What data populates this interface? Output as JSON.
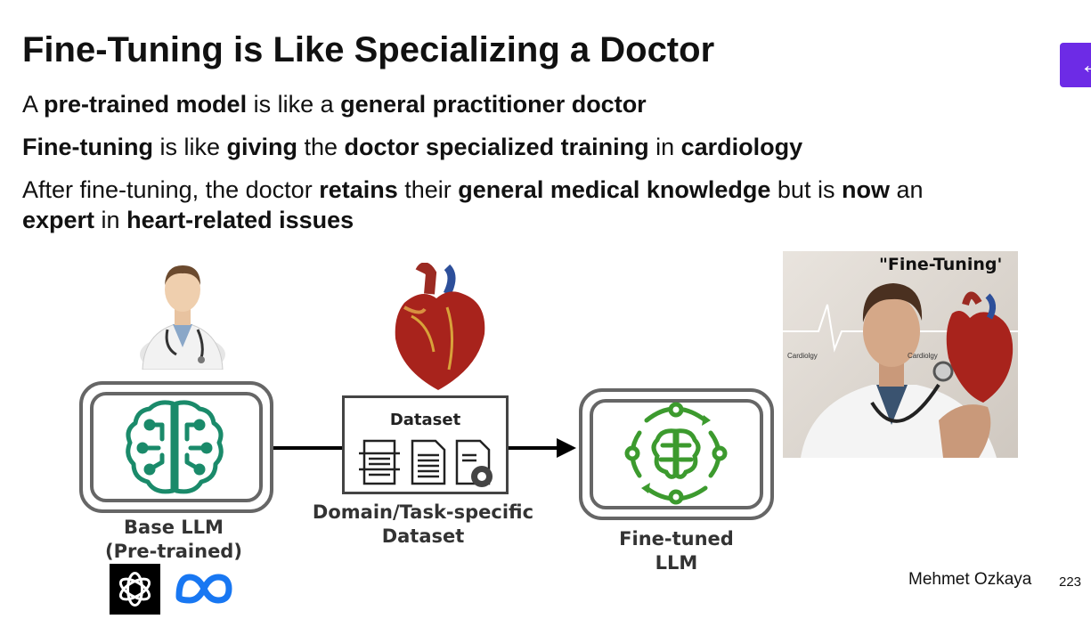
{
  "slide": {
    "title": "Fine-Tuning is Like Specializing a Doctor",
    "bullets": [
      [
        {
          "t": "A ",
          "b": false
        },
        {
          "t": "pre-trained model",
          "b": true
        },
        {
          "t": " is like a ",
          "b": false
        },
        {
          "t": "general practitioner doctor",
          "b": true
        }
      ],
      [
        {
          "t": "Fine-tuning",
          "b": true
        },
        {
          "t": " is like ",
          "b": false
        },
        {
          "t": "giving",
          "b": true
        },
        {
          "t": " the ",
          "b": false
        },
        {
          "t": "doctor specialized training",
          "b": true
        },
        {
          "t": " in ",
          "b": false
        },
        {
          "t": "cardiology",
          "b": true
        }
      ],
      [
        {
          "t": "After fine-tuning, the doctor ",
          "b": false
        },
        {
          "t": "retains",
          "b": true
        },
        {
          "t": " their ",
          "b": false
        },
        {
          "t": "general medical knowledge",
          "b": true
        },
        {
          "t": " but is ",
          "b": false
        },
        {
          "t": "now",
          "b": true
        },
        {
          "t": " an",
          "b": false
        }
      ],
      [
        {
          "t": "expert",
          "b": true
        },
        {
          "t": " in ",
          "b": false
        },
        {
          "t": "heart-related issues",
          "b": true
        }
      ]
    ]
  },
  "diagram": {
    "base_label_1": "Base LLM",
    "base_label_2": "(Pre-trained)",
    "dataset_title": "Dataset",
    "dataset_label_1": "Domain/Task-specific",
    "dataset_label_2": "Dataset",
    "finetuned_label_1": "Fine-tuned",
    "finetuned_label_2": "LLM",
    "brain_color_base": "#1a8a6a",
    "brain_color_finetuned": "#3c9a2e"
  },
  "photo": {
    "title": "\"Fine-Tuning'",
    "tag_left": "Cardiolgy",
    "tag_right": "Cardiolgy"
  },
  "icons": [
    "doctor-icon",
    "heart-icon",
    "brain-circuit-icon",
    "document-icon",
    "openai-logo",
    "meta-logo",
    "back-arrow-icon"
  ],
  "footer": {
    "author": "Mehmet Ozkaya",
    "page": "223"
  }
}
